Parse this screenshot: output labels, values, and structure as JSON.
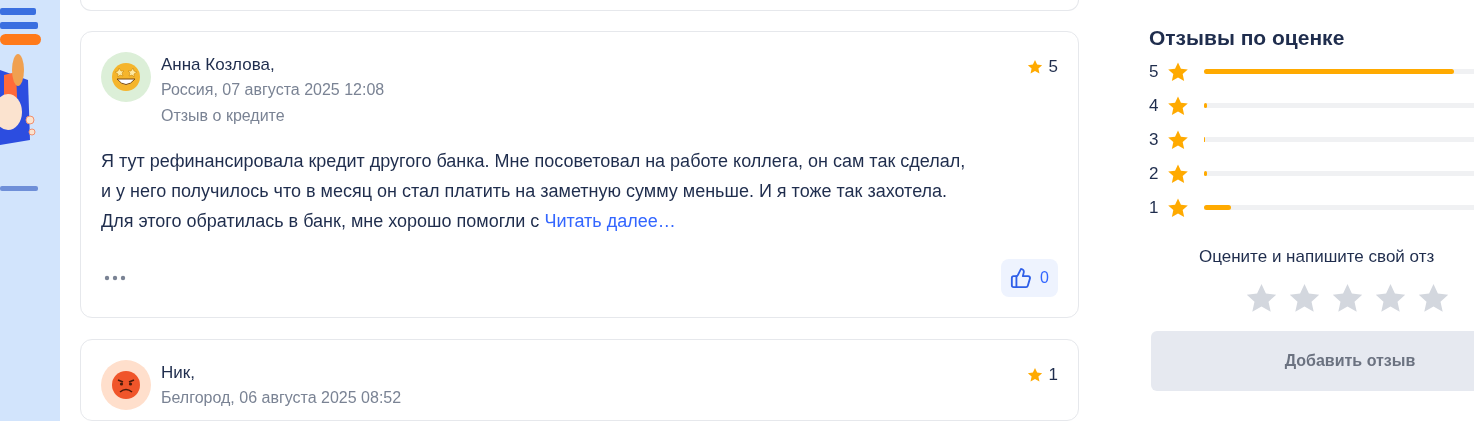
{
  "reviews": [
    {
      "author": "Анна Козлова,",
      "meta": "Россия, 07 августа 2025 12:08",
      "subject": "Отзыв о кредите",
      "rating": "5",
      "text_lines": [
        "Я тут рефинансировала кредит другого банка. Мне посоветовал на работе коллега, он сам так сделал,",
        "и у него получилось что в месяц он стал платить на заметную сумму меньше. И я тоже так захотела.",
        "Для этого обратилась в банк, мне хорошо помогли с"
      ],
      "read_more": "Читать далее…",
      "likes": "0",
      "avatar": {
        "kind": "star-struck",
        "color": "#dcefd8"
      }
    },
    {
      "author": "Ник,",
      "meta": "Белгород, 06 августа 2025 08:52",
      "rating": "1",
      "avatar": {
        "kind": "angry",
        "color": "#ffdfcc"
      }
    }
  ],
  "rating_summary": {
    "title": "Отзывы по оценке",
    "rows": [
      {
        "label": "5",
        "level": 0.92
      },
      {
        "label": "4",
        "level": 0.01
      },
      {
        "label": "3",
        "level": 0.005
      },
      {
        "label": "2",
        "level": 0.01
      },
      {
        "label": "1",
        "level": 0.1
      }
    ],
    "prompt": "Оцените и напишите свой отз",
    "rate": {
      "stars": 0
    },
    "button": "Добавить отзыв"
  }
}
